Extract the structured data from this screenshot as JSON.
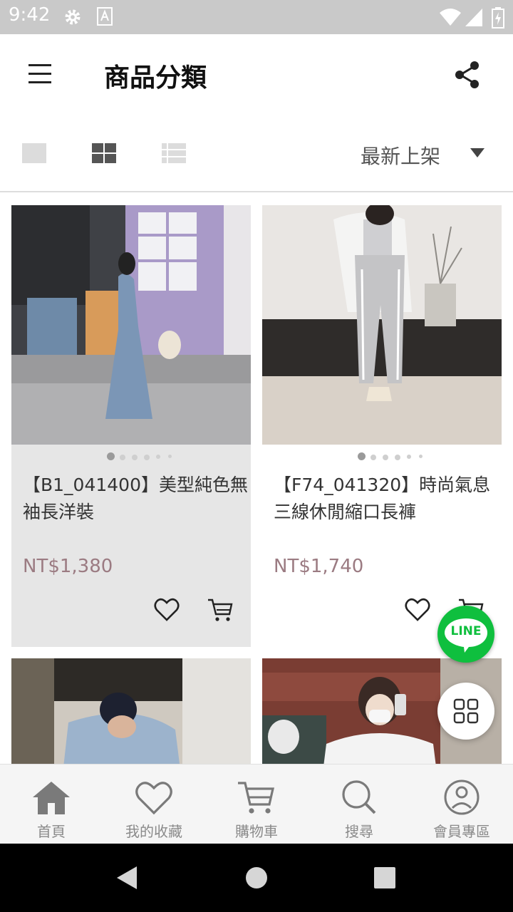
{
  "status_bar": {
    "time": "9:42",
    "icons": [
      "settings-icon",
      "font-icon",
      "wifi-icon",
      "signal-icon",
      "battery-icon"
    ]
  },
  "app_bar": {
    "title": "商品分類",
    "menu_icon": "hamburger-menu-icon",
    "share_icon": "share-icon"
  },
  "toolbar": {
    "view_modes": [
      "single-view-icon",
      "grid-view-icon",
      "list-view-icon"
    ],
    "selected_view": "grid-view-icon",
    "sort_label": "最新上架"
  },
  "products": [
    {
      "name": "【B1_041400】美型純色無袖長洋裝",
      "price": "NT$1,380",
      "image_count": 6,
      "active_image": 0
    },
    {
      "name": "【F74_041320】時尚氣息三線休閒縮口長褲",
      "price": "NT$1,740",
      "image_count": 6,
      "active_image": 0
    }
  ],
  "floating": {
    "line_label": "LINE"
  },
  "bottom_nav": [
    {
      "label": "首頁",
      "icon": "home-icon"
    },
    {
      "label": "我的收藏",
      "icon": "heart-icon"
    },
    {
      "label": "購物車",
      "icon": "cart-icon"
    },
    {
      "label": "搜尋",
      "icon": "search-icon"
    },
    {
      "label": "會員專區",
      "icon": "user-icon"
    }
  ],
  "colors": {
    "price": "#9b7b82",
    "line_green": "#0fbf3e",
    "status_bar": "#c9c9c9"
  }
}
